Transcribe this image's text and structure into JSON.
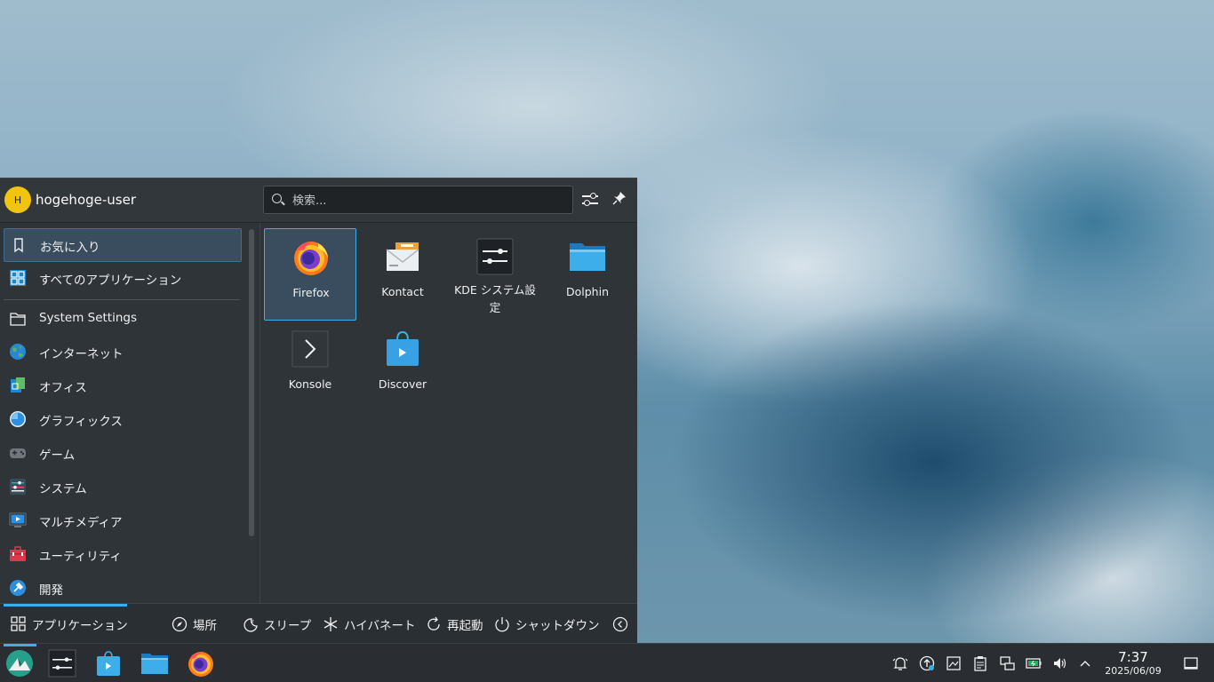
{
  "user": {
    "initial": "H",
    "name": "hogehoge-user"
  },
  "search": {
    "placeholder": "検索..."
  },
  "sidebar": {
    "items": [
      {
        "label": "お気に入り",
        "icon": "bookmark-icon"
      },
      {
        "label": "すべてのアプリケーション",
        "icon": "app-grid-icon"
      },
      {
        "label": "System Settings",
        "icon": "folder-icon"
      },
      {
        "label": "インターネット",
        "icon": "globe-icon"
      },
      {
        "label": "オフィス",
        "icon": "office-icon"
      },
      {
        "label": "グラフィックス",
        "icon": "graphics-icon"
      },
      {
        "label": "ゲーム",
        "icon": "gamepad-icon"
      },
      {
        "label": "システム",
        "icon": "system-icon"
      },
      {
        "label": "マルチメディア",
        "icon": "multimedia-icon"
      },
      {
        "label": "ユーティリティ",
        "icon": "utilities-icon"
      },
      {
        "label": "開発",
        "icon": "development-icon"
      }
    ]
  },
  "favorites": [
    {
      "label": "Firefox",
      "icon": "firefox-icon"
    },
    {
      "label": "Kontact",
      "icon": "kontact-icon"
    },
    {
      "label": "KDE システム設定",
      "icon": "settings-icon"
    },
    {
      "label": "Dolphin",
      "icon": "folder-icon"
    },
    {
      "label": "Konsole",
      "icon": "terminal-icon"
    },
    {
      "label": "Discover",
      "icon": "store-icon"
    }
  ],
  "footer": {
    "applications": "アプリケーション",
    "places": "場所",
    "sleep": "スリープ",
    "hibernate": "ハイバネート",
    "restart": "再起動",
    "shutdown": "シャットダウン"
  },
  "clock": {
    "time": "7:37",
    "date": "2025/06/09"
  },
  "colors": {
    "accent": "#3daee9",
    "panel": "#2a2e32",
    "menu": "#2f3439"
  }
}
